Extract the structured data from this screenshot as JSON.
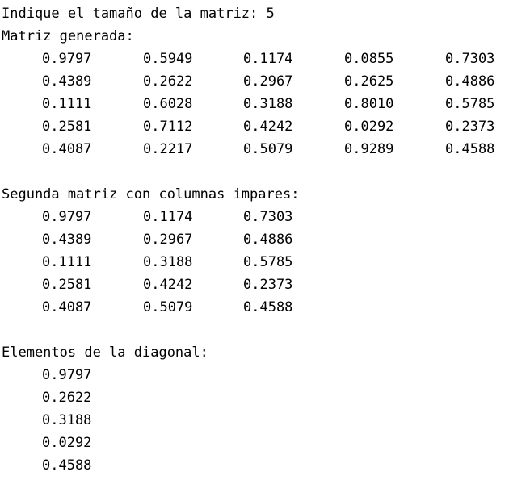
{
  "prompt": {
    "label": "Indique el tamaño de la matriz:",
    "value": "5"
  },
  "generated": {
    "title": "Matriz generada:",
    "rows": [
      [
        "0.9797",
        "0.5949",
        "0.1174",
        "0.0855",
        "0.7303"
      ],
      [
        "0.4389",
        "0.2622",
        "0.2967",
        "0.2625",
        "0.4886"
      ],
      [
        "0.1111",
        "0.6028",
        "0.3188",
        "0.8010",
        "0.5785"
      ],
      [
        "0.2581",
        "0.7112",
        "0.4242",
        "0.0292",
        "0.2373"
      ],
      [
        "0.4087",
        "0.2217",
        "0.5079",
        "0.9289",
        "0.4588"
      ]
    ]
  },
  "odd_columns": {
    "title": "Segunda matriz con columnas impares:",
    "rows": [
      [
        "0.9797",
        "0.1174",
        "0.7303"
      ],
      [
        "0.4389",
        "0.2967",
        "0.4886"
      ],
      [
        "0.1111",
        "0.3188",
        "0.5785"
      ],
      [
        "0.2581",
        "0.4242",
        "0.2373"
      ],
      [
        "0.4087",
        "0.5079",
        "0.4588"
      ]
    ]
  },
  "diagonal": {
    "title": "Elementos de la diagonal:",
    "values": [
      "0.9797",
      "0.2622",
      "0.3188",
      "0.0292",
      "0.4588"
    ]
  }
}
